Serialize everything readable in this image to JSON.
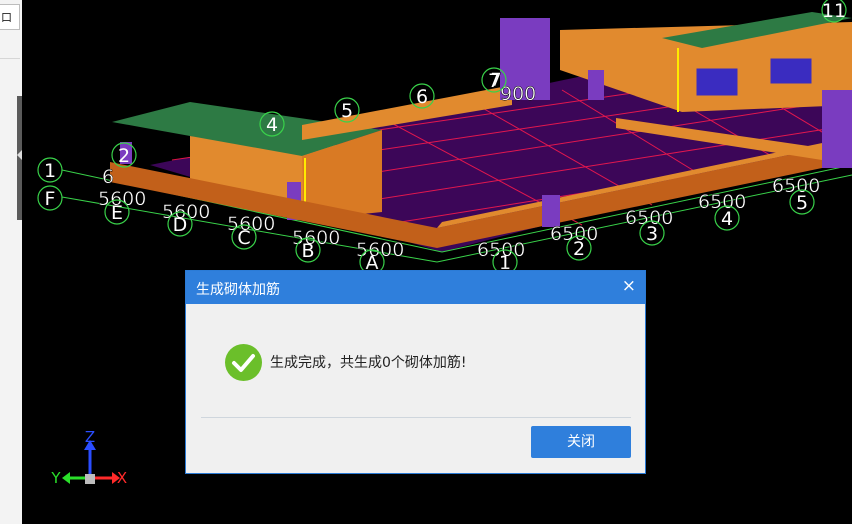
{
  "left_panel": {
    "tab_label": "口"
  },
  "viewport": {
    "grid_dims": {
      "left_edge": [
        "5600",
        "5600",
        "5600",
        "5600",
        "5600"
      ],
      "front_edge": [
        "6500",
        "6500",
        "6500",
        "6500",
        "6500"
      ],
      "left_cut": [
        "6"
      ]
    },
    "axes_letters": [
      "F",
      "E",
      "D",
      "C",
      "B",
      "A"
    ],
    "axes_numbers": [
      "1",
      "2",
      "3",
      "4",
      "5"
    ],
    "top_numbers": [
      "1",
      "2",
      "4",
      "5",
      "6",
      "7",
      "11"
    ],
    "top_dims": [
      "7",
      "900"
    ],
    "axis_gizmo": {
      "z": "Z",
      "y": "Y",
      "x": "X"
    }
  },
  "dialog": {
    "title": "生成砌体加筋",
    "close_symbol": "×",
    "message": "生成完成，共生成0个砌体加筋!",
    "button_label": "关闭"
  },
  "colors": {
    "dialog_title": "#2f7fdc",
    "success": "#6bbf2a",
    "wall": "#e18a2e",
    "roof": "#2d7a44",
    "slab": "#3c0658",
    "grid_red": "#ff1a4d",
    "grid_green": "#39d24a",
    "door": "#7a3cc0"
  }
}
